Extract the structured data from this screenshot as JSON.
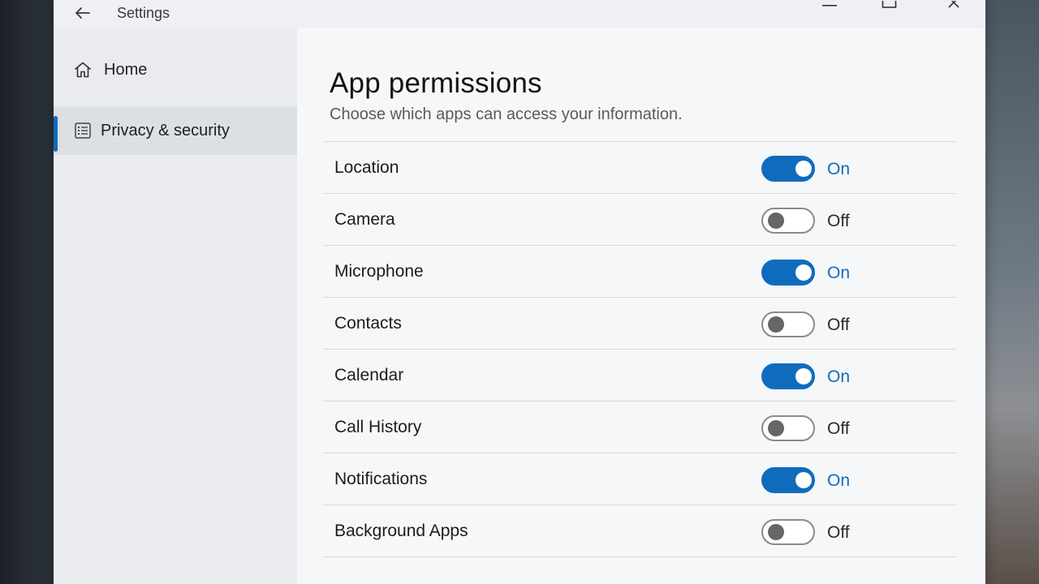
{
  "window": {
    "title": "Settings",
    "controls": {
      "minimize": "minimize-icon",
      "maximize": "maximize-icon",
      "close": "close-icon"
    }
  },
  "sidebar": {
    "items": [
      {
        "label": "Home",
        "icon": "home-icon",
        "selected": false
      },
      {
        "label": "Privacy & security",
        "icon": "privacy-list-icon",
        "selected": true
      }
    ]
  },
  "main": {
    "title": "App permissions",
    "subtitle": "Choose which apps can access your information.",
    "permissions": [
      {
        "name": "Location",
        "state": "On",
        "enabled": true
      },
      {
        "name": "Camera",
        "state": "Off",
        "enabled": false
      },
      {
        "name": "Microphone",
        "state": "On",
        "enabled": true
      },
      {
        "name": "Contacts",
        "state": "Off",
        "enabled": false
      },
      {
        "name": "Calendar",
        "state": "On",
        "enabled": true
      },
      {
        "name": "Call History",
        "state": "Off",
        "enabled": false
      },
      {
        "name": "Notifications",
        "state": "On",
        "enabled": true
      },
      {
        "name": "Background Apps",
        "state": "Off",
        "enabled": false
      }
    ]
  },
  "colors": {
    "accent": "#0f6cbd",
    "toggle_off_knob": "#666666"
  }
}
